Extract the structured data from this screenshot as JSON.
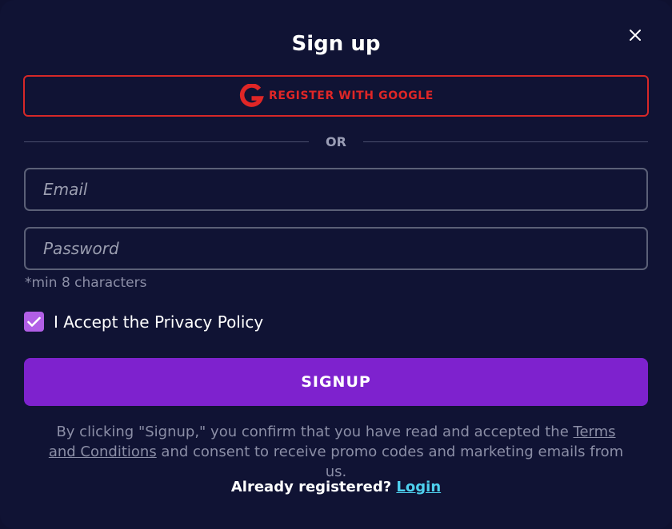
{
  "modal": {
    "title": "Sign up",
    "close_icon": "close-icon"
  },
  "google": {
    "label": "REGISTER WITH GOOGLE",
    "icon": "google-icon",
    "color": "#e02626"
  },
  "divider": {
    "text": "OR"
  },
  "form": {
    "email_placeholder": "Email",
    "email_value": "",
    "password_placeholder": "Password",
    "password_value": "",
    "password_hint": "*min 8 characters",
    "privacy_checked": true,
    "privacy_label": "I Accept the Privacy Policy",
    "submit_label": "SIGNUP",
    "accent_color": "#7e22ce"
  },
  "disclaimer": {
    "text_before": "By clicking \"Signup,\" you confirm that you have read and accepted the ",
    "link_text": "Terms and Conditions",
    "text_after": " and consent to receive promo codes and marketing emails from us."
  },
  "footer": {
    "prompt": "Already registered? ",
    "login_link": "Login",
    "link_color": "#4ed0ee"
  }
}
